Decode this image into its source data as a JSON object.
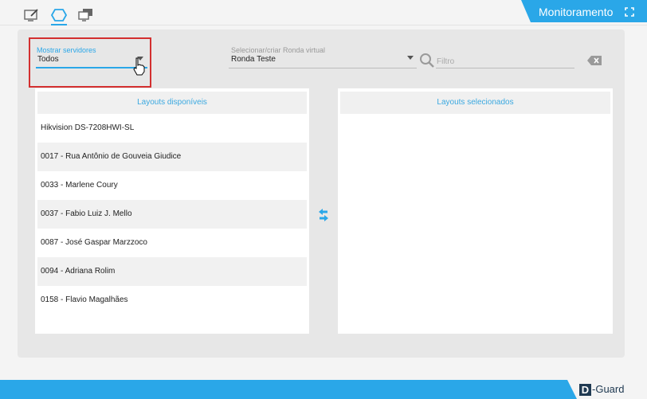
{
  "header": {
    "title": "Monitoramento",
    "tabs": [
      {
        "icon": "edit-screen-icon"
      },
      {
        "icon": "hexagon-icon",
        "active": true
      },
      {
        "icon": "monitors-icon"
      }
    ]
  },
  "filters": {
    "servers_label": "Mostrar servidores",
    "servers_value": "Todos",
    "tour_label": "Selecionar/criar Ronda virtual",
    "tour_value": "Ronda Teste",
    "filter_placeholder": "Filtro"
  },
  "lists": {
    "available_title": "Layouts disponíveis",
    "available_items": [
      "Hikvision DS-7208HWI-SL",
      "0017 - Rua Antônio de Gouveia Giudice",
      "0033 - Marlene Coury",
      "0037 - Fabio Luiz J. Mello",
      "0087 - José Gaspar Marzzoco",
      "0094 - Adriana Rolim",
      "0158 - Flavio Magalhães"
    ],
    "selected_title": "Layouts selecionados",
    "selected_items": []
  },
  "brand": {
    "logo_letter": "D",
    "logo_rest": "-Guard"
  },
  "colors": {
    "accent": "#2aa7e8",
    "highlight": "#d32f2f",
    "brand_dark": "#203a52"
  }
}
